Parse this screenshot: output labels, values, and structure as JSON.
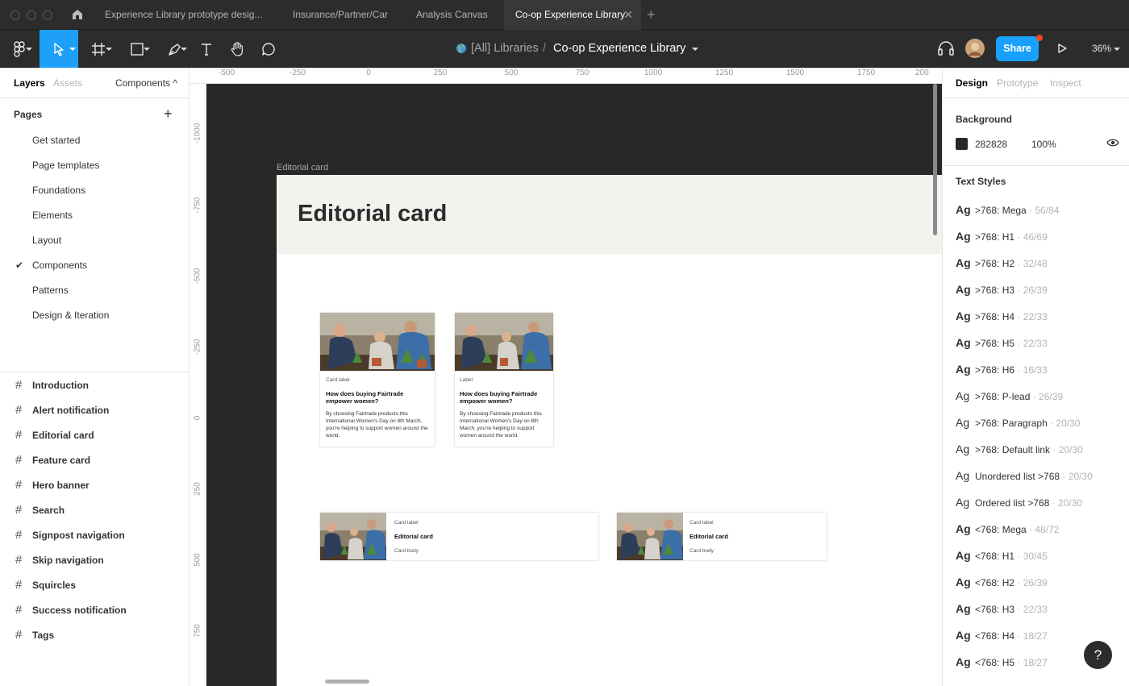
{
  "tabs": [
    {
      "label": "Experience Library prototype desig..."
    },
    {
      "label": "Insurance/Partner/Car"
    },
    {
      "label": "Analysis Canvas"
    },
    {
      "label": "Co-op Experience Library",
      "close": "✕"
    }
  ],
  "new_tab": "+",
  "toolbar": {
    "breadcrumb_team": "[All] Libraries",
    "breadcrumb_sep": "/",
    "breadcrumb_file": "Co-op Experience Library",
    "share_label": "Share",
    "zoom": "36%"
  },
  "left_panel": {
    "tabs": {
      "layers": "Layers",
      "assets": "Assets",
      "components": "Components ^"
    },
    "pages_heading": "Pages",
    "add_page": "+",
    "pages": [
      {
        "label": "Get started"
      },
      {
        "label": "Page templates"
      },
      {
        "label": "Foundations"
      },
      {
        "label": "Elements"
      },
      {
        "label": "Layout"
      },
      {
        "label": "Components",
        "check": "✔"
      },
      {
        "label": "Patterns"
      },
      {
        "label": "Design & Iteration"
      }
    ],
    "frames": [
      {
        "label": "Introduction"
      },
      {
        "label": "Alert notification"
      },
      {
        "label": "Editorial card"
      },
      {
        "label": "Feature card"
      },
      {
        "label": "Hero banner"
      },
      {
        "label": "Search"
      },
      {
        "label": "Signpost navigation"
      },
      {
        "label": "Skip navigation"
      },
      {
        "label": "Squircles"
      },
      {
        "label": "Success notification"
      },
      {
        "label": "Tags"
      }
    ],
    "frame_glyph": "#"
  },
  "canvas": {
    "ruler_top": [
      "-500",
      "-250",
      "0",
      "250",
      "500",
      "750",
      "1000",
      "1250",
      "1500",
      "1750",
      "200"
    ],
    "ruler_left": [
      "-1000",
      "-750",
      "-500",
      "-250",
      "0",
      "250",
      "500",
      "750"
    ],
    "frame_title": "Editorial card",
    "heading": "Editorial card",
    "card_1": {
      "label": "Card label",
      "title": "How does buying Fairtrade empower women?",
      "body": "By choosing Fairtrade products this International Women's Day on 8th March, you're helping to support women around the world."
    },
    "card_2": {
      "label": "Label",
      "title": "How does buying Fairtrade empower women?",
      "body": "By choosing Fairtrade products this International Women's Day on 8th March, you're helping to support women around the world."
    },
    "card_3": {
      "label": "Card label",
      "title": "Editorial card",
      "body": "Card body"
    },
    "card_4": {
      "label": "Card label",
      "title": "Editorial card",
      "body": "Card body"
    }
  },
  "right_panel": {
    "tabs": {
      "design": "Design",
      "prototype": "Prototype",
      "inspect": "Inspect"
    },
    "background_heading": "Background",
    "background_hex": "282828",
    "background_opacity": "100%",
    "text_styles_heading": "Text Styles",
    "ag": "Ag",
    "styles": [
      {
        "name": ">768: Mega",
        "meta": " · 56/84",
        "bold": true
      },
      {
        "name": ">768: H1",
        "meta": " · 46/69",
        "bold": true
      },
      {
        "name": ">768: H2",
        "meta": " · 32/48",
        "bold": true
      },
      {
        "name": ">768: H3",
        "meta": " · 26/39",
        "bold": true
      },
      {
        "name": ">768: H4",
        "meta": " · 22/33",
        "bold": true
      },
      {
        "name": ">768: H5",
        "meta": " · 22/33",
        "bold": true
      },
      {
        "name": ">768: H6",
        "meta": " · 16/33",
        "bold": true
      },
      {
        "name": ">768: P-lead",
        "meta": " · 26/39",
        "bold": false
      },
      {
        "name": ">768: Paragraph",
        "meta": " · 20/30",
        "bold": false
      },
      {
        "name": ">768: Default link",
        "meta": " · 20/30",
        "bold": false
      },
      {
        "name": "Unordered list >768",
        "meta": " · 20/30",
        "bold": false
      },
      {
        "name": "Ordered list >768",
        "meta": " · 20/30",
        "bold": false
      },
      {
        "name": "<768: Mega",
        "meta": " · 48/72",
        "bold": true
      },
      {
        "name": "<768: H1",
        "meta": " · 30/45",
        "bold": true
      },
      {
        "name": "<768: H2",
        "meta": " · 26/39",
        "bold": true
      },
      {
        "name": "<768: H3",
        "meta": " · 22/33",
        "bold": true
      },
      {
        "name": "<768: H4",
        "meta": " · 18/27",
        "bold": true
      },
      {
        "name": "<768: H5",
        "meta": " · 18/27",
        "bold": true
      }
    ],
    "help": "?"
  },
  "colors": {
    "accent": "#18a0fb",
    "canvas_bg": "#282828",
    "notification_dot": "#f24822"
  }
}
